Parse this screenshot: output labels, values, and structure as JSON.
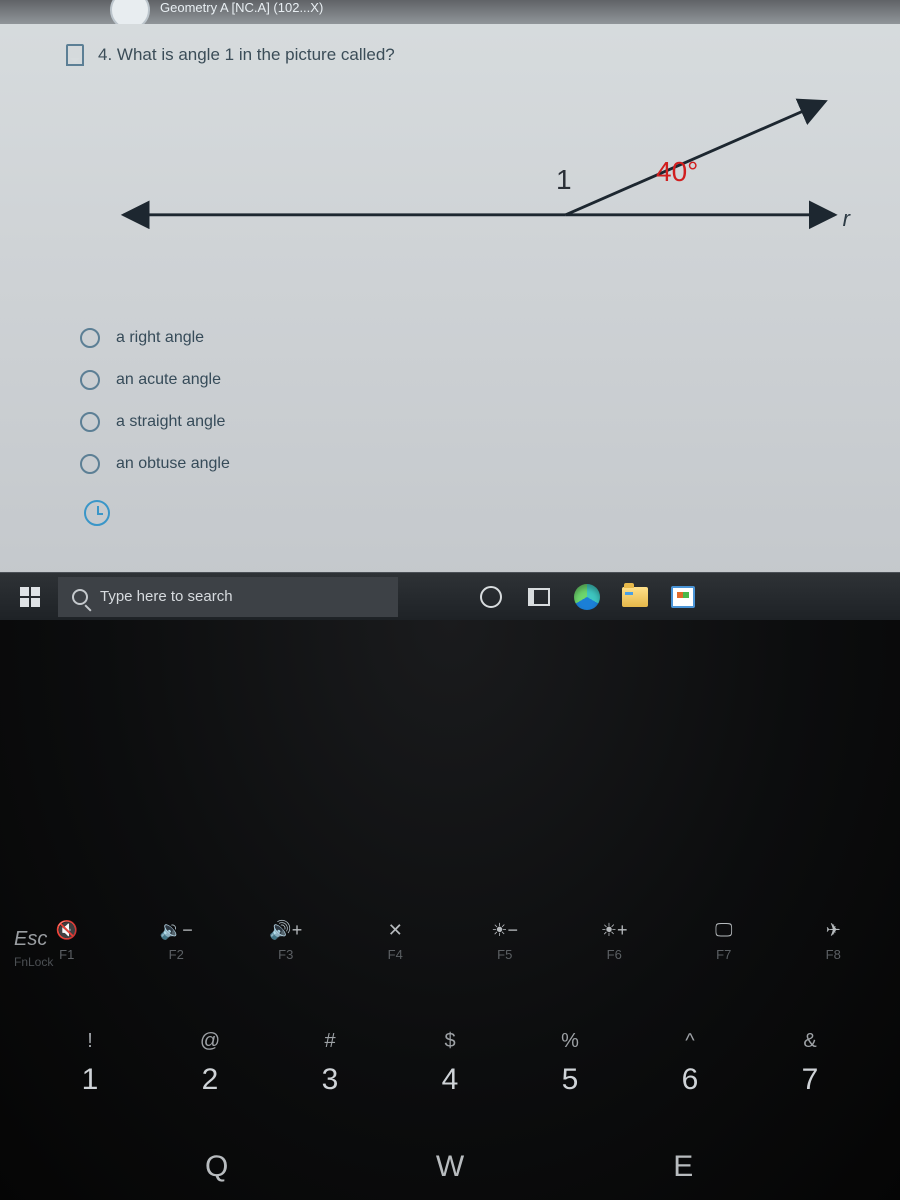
{
  "top": {
    "course": "Geometry A [NC.A] (102...X)"
  },
  "question": {
    "number": "4.",
    "text": "What is angle 1 in the picture called?"
  },
  "diagram": {
    "label_1": "1",
    "label_angle": "40°",
    "ray_letter": "r"
  },
  "options": [
    {
      "label": "a right angle"
    },
    {
      "label": "an acute angle"
    },
    {
      "label": "a straight angle"
    },
    {
      "label": "an obtuse angle"
    }
  ],
  "taskbar": {
    "search_placeholder": "Type here to search"
  },
  "keyboard": {
    "esc": "Esc",
    "esc_sub": "FnLock",
    "fkeys": [
      {
        "sym": "🔇",
        "f": "F1"
      },
      {
        "sym": "🔉−",
        "f": "F2"
      },
      {
        "sym": "🔊+",
        "f": "F3"
      },
      {
        "sym": "✕",
        "f": "F4"
      },
      {
        "sym": "☀−",
        "f": "F5"
      },
      {
        "sym": "☀+",
        "f": "F6"
      },
      {
        "sym": "🖵",
        "f": "F7"
      },
      {
        "sym": "✈",
        "f": "F8"
      }
    ],
    "numkeys": [
      {
        "upper": "!",
        "lower": "1"
      },
      {
        "upper": "@",
        "lower": "2"
      },
      {
        "upper": "#",
        "lower": "3"
      },
      {
        "upper": "$",
        "lower": "4"
      },
      {
        "upper": "%",
        "lower": "5"
      },
      {
        "upper": "^",
        "lower": "6"
      },
      {
        "upper": "&",
        "lower": "7"
      }
    ],
    "wrow": [
      {
        "k": "Q"
      },
      {
        "k": "W"
      },
      {
        "k": "E"
      }
    ]
  }
}
